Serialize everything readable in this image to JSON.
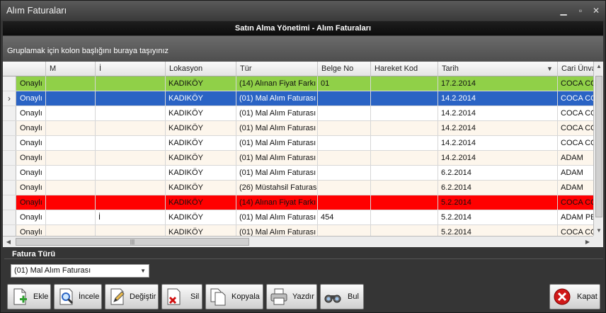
{
  "window": {
    "title": "Alım Faturaları",
    "min": "▁",
    "max": "▫",
    "close": "✕"
  },
  "header": {
    "title": "Satın Alma Yönetimi - Alım Faturaları"
  },
  "group_panel": {
    "hint": "Gruplamak için kolon başlığını buraya taşıyınız"
  },
  "grid": {
    "columns": [
      "",
      "M",
      "İ",
      "Lokasyon",
      "Tür",
      "Belge No",
      "Hareket Kod",
      "Tarih",
      "Cari Ünvanı"
    ],
    "sort_indicator": "▼",
    "current_row_marker": "›",
    "rows": [
      {
        "status": "Onaylı",
        "m": "",
        "i": "",
        "lokasyon": "KADIKÖY",
        "tur": "(14) Alınan Fiyat Farkı",
        "belge": "01",
        "hareket": "",
        "tarih": "17.2.2014",
        "cari": "COCA COLA",
        "bg": "#90d048",
        "fg": "#111111"
      },
      {
        "status": "Onaylı",
        "m": "",
        "i": "",
        "lokasyon": "KADIKÖY",
        "tur": "(01) Mal Alım Faturası",
        "belge": "",
        "hareket": "",
        "tarih": "14.2.2014",
        "cari": "COCA COLA",
        "bg": "#2a63c4",
        "fg": "#ffffff"
      },
      {
        "status": "Onaylı",
        "m": "",
        "i": "",
        "lokasyon": "KADIKÖY",
        "tur": "(01) Mal Alım Faturası",
        "belge": "",
        "hareket": "",
        "tarih": "14.2.2014",
        "cari": "COCA COLA",
        "bg": "#ffffff",
        "fg": "#111111"
      },
      {
        "status": "Onaylı",
        "m": "",
        "i": "",
        "lokasyon": "KADIKÖY",
        "tur": "(01) Mal Alım Faturası",
        "belge": "",
        "hareket": "",
        "tarih": "14.2.2014",
        "cari": "COCA COLA",
        "bg": "#fdf6ec",
        "fg": "#111111"
      },
      {
        "status": "Onaylı",
        "m": "",
        "i": "",
        "lokasyon": "KADIKÖY",
        "tur": "(01) Mal Alım Faturası",
        "belge": "",
        "hareket": "",
        "tarih": "14.2.2014",
        "cari": "COCA COLA",
        "bg": "#ffffff",
        "fg": "#111111"
      },
      {
        "status": "Onaylı",
        "m": "",
        "i": "",
        "lokasyon": "KADIKÖY",
        "tur": "(01) Mal Alım Faturası",
        "belge": "",
        "hareket": "",
        "tarih": "14.2.2014",
        "cari": "ADAM",
        "bg": "#fdf6ec",
        "fg": "#111111"
      },
      {
        "status": "Onaylı",
        "m": "",
        "i": "",
        "lokasyon": "KADIKÖY",
        "tur": "(01) Mal Alım Faturası",
        "belge": "",
        "hareket": "",
        "tarih": "6.2.2014",
        "cari": "ADAM",
        "bg": "#ffffff",
        "fg": "#111111"
      },
      {
        "status": "Onaylı",
        "m": "",
        "i": "",
        "lokasyon": "KADIKÖY",
        "tur": "(26) Müstahsil Faturası",
        "belge": "",
        "hareket": "",
        "tarih": "6.2.2014",
        "cari": "ADAM",
        "bg": "#fdf6ec",
        "fg": "#111111"
      },
      {
        "status": "Onaylı",
        "m": "",
        "i": "",
        "lokasyon": "KADIKÖY",
        "tur": "(14) Alınan Fiyat Farkı",
        "belge": "",
        "hareket": "",
        "tarih": "5.2.2014",
        "cari": "COCA COLA",
        "bg": "#ff0000",
        "fg": "#111111"
      },
      {
        "status": "Onaylı",
        "m": "",
        "i": "İ",
        "lokasyon": "KADIKÖY",
        "tur": "(01) Mal Alım Faturası",
        "belge": "454",
        "hareket": "",
        "tarih": "5.2.2014",
        "cari": "ADAM PEK",
        "bg": "#ffffff",
        "fg": "#111111"
      },
      {
        "status": "Onaylı",
        "m": "",
        "i": "",
        "lokasyon": "KADIKÖY",
        "tur": "(01) Mal Alım Faturası",
        "belge": "",
        "hareket": "",
        "tarih": "5.2.2014",
        "cari": "COCA COLA",
        "bg": "#fdf6ec",
        "fg": "#111111"
      }
    ]
  },
  "filter": {
    "label": "Fatura Türü",
    "selected": "(01) Mal Alım Faturası",
    "arrow": "▼"
  },
  "toolbar": {
    "ekle": "Ekle",
    "incele": "İncele",
    "degistir": "Değiştir",
    "sil": "Sil",
    "kopyala": "Kopyala",
    "yazdir": "Yazdır",
    "bul": "Bul",
    "kapat": "Kapat"
  }
}
